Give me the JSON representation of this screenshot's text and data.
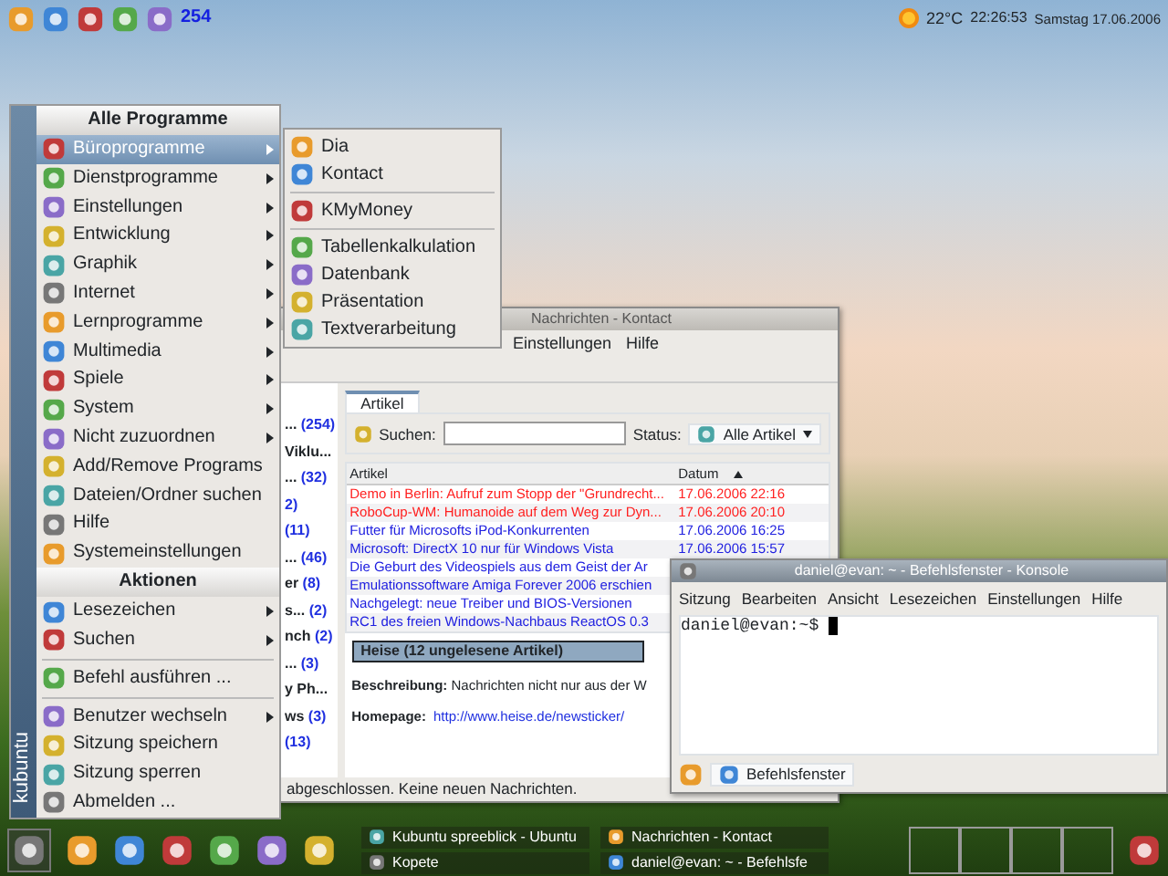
{
  "top_panel": {
    "badge": "254",
    "weather": "22°C",
    "clock": "22:26:53",
    "date": "Samstag 17.06.2006"
  },
  "start_menu": {
    "brand": "kubuntu",
    "sections": [
      {
        "title": "Alle Programme",
        "items": [
          {
            "label": "Büroprogramme",
            "submenu": true,
            "selected": true
          },
          {
            "label": "Dienstprogramme",
            "submenu": true,
            "selected": false
          },
          {
            "label": "Einstellungen",
            "submenu": true,
            "selected": false
          },
          {
            "label": "Entwicklung",
            "submenu": true,
            "selected": false
          },
          {
            "label": "Graphik",
            "submenu": true,
            "selected": false
          },
          {
            "label": "Internet",
            "submenu": true,
            "selected": false
          },
          {
            "label": "Lernprogramme",
            "submenu": true,
            "selected": false
          },
          {
            "label": "Multimedia",
            "submenu": true,
            "selected": false
          },
          {
            "label": "Spiele",
            "submenu": true,
            "selected": false
          },
          {
            "label": "System",
            "submenu": true,
            "selected": false
          },
          {
            "label": "Nicht zuzuordnen",
            "submenu": true,
            "selected": false
          },
          {
            "label": "Add/Remove Programs",
            "submenu": false,
            "selected": false
          },
          {
            "label": "Dateien/Ordner suchen",
            "submenu": false,
            "selected": false
          },
          {
            "label": "Hilfe",
            "submenu": false,
            "selected": false
          },
          {
            "label": "Systemeinstellungen",
            "submenu": false,
            "selected": false
          }
        ]
      },
      {
        "title": "Aktionen",
        "items": [
          {
            "label": "Lesezeichen",
            "submenu": true,
            "selected": false
          },
          {
            "label": "Suchen",
            "submenu": true,
            "selected": false
          },
          {
            "label": "Befehl ausführen ...",
            "submenu": false,
            "selected": false,
            "separator_before": true
          },
          {
            "label": "Benutzer wechseln",
            "submenu": true,
            "selected": false,
            "separator_before": true
          },
          {
            "label": "Sitzung speichern",
            "submenu": false,
            "selected": false
          },
          {
            "label": "Sitzung sperren",
            "submenu": false,
            "selected": false
          },
          {
            "label": "Abmelden ...",
            "submenu": false,
            "selected": false
          }
        ]
      }
    ]
  },
  "submenu": {
    "groups": [
      [
        "Dia",
        "Kontact"
      ],
      [
        "KMyMoney"
      ],
      [
        "Tabellenkalkulation",
        "Datenbank",
        "Präsentation",
        "Textverarbeitung"
      ]
    ]
  },
  "kontact_window": {
    "title": "Nachrichten - Kontact",
    "menu": [
      "Einstellungen",
      "Hilfe"
    ],
    "feeds": [
      {
        "name": "...",
        "count": "(254)"
      },
      {
        "name": "Viklu..."
      },
      {
        "name": "...",
        "count": "(32)"
      },
      {
        "count": "2)"
      },
      {
        "count": "(11)"
      },
      {
        "name": "...",
        "count": "(46)"
      },
      {
        "name": "er",
        "count": "(8)"
      },
      {
        "name": "s...",
        "count": "(2)"
      },
      {
        "name": "nch",
        "count": "(2)"
      },
      {
        "name": "...",
        "count": "(3)"
      },
      {
        "name": "y Ph..."
      },
      {
        "name": "ws",
        "count": "(3)"
      },
      {
        "count": "(13)"
      }
    ],
    "tab": "Artikel",
    "search_label": "Suchen:",
    "status_label": "Status:",
    "status_value": "Alle Artikel",
    "columns": [
      "Artikel",
      "Datum"
    ],
    "articles": [
      {
        "title": "Demo in Berlin: Aufruf zum Stopp der \"Grundrecht...",
        "date": "17.06.2006 22:16",
        "color": "#ff2020"
      },
      {
        "title": "RoboCup-WM: Humanoide auf dem Weg zur Dyn...",
        "date": "17.06.2006 20:10",
        "color": "#ff2020"
      },
      {
        "title": "Futter für Microsofts iPod-Konkurrenten",
        "date": "17.06.2006 16:25",
        "color": "#2020e0"
      },
      {
        "title": "Microsoft: DirectX 10 nur für Windows Vista",
        "date": "17.06.2006 15:57",
        "color": "#2020e0"
      },
      {
        "title": "Die Geburt des Videospiels aus dem Geist der Ar",
        "color": "#2020e0"
      },
      {
        "title": "Emulationssoftware Amiga Forever 2006 erschien",
        "color": "#2020e0"
      },
      {
        "title": "Nachgelegt: neue Treiber und BIOS-Versionen",
        "color": "#2020e0"
      },
      {
        "title": "RC1 des freien Windows-Nachbaus ReactOS 0.3",
        "color": "#2020e0"
      }
    ],
    "feed_header": "Heise (12 ungelesene Artikel)",
    "description": "**Beschreibung:** Nachrichten nicht nur aus der W",
    "homepage_label": "Homepage:",
    "homepage": "http://www.heise.de/newsticker/",
    "status_bar": "abgeschlossen. Keine neuen Nachrichten."
  },
  "konsole": {
    "title": "daniel@evan: ~ - Befehlsfenster - Konsole",
    "menu": [
      "Sitzung",
      "Bearbeiten",
      "Ansicht",
      "Lesezeichen",
      "Einstellungen",
      "Hilfe"
    ],
    "prompt": "daniel@evan:~$",
    "tab": "Befehlsfenster"
  },
  "taskbar": {
    "tasks": [
      "Kubuntu spreeblick - Ubuntu",
      "Kopete",
      "Nachrichten - Kontact",
      "daniel@evan: ~ - Befehlsfe"
    ]
  }
}
